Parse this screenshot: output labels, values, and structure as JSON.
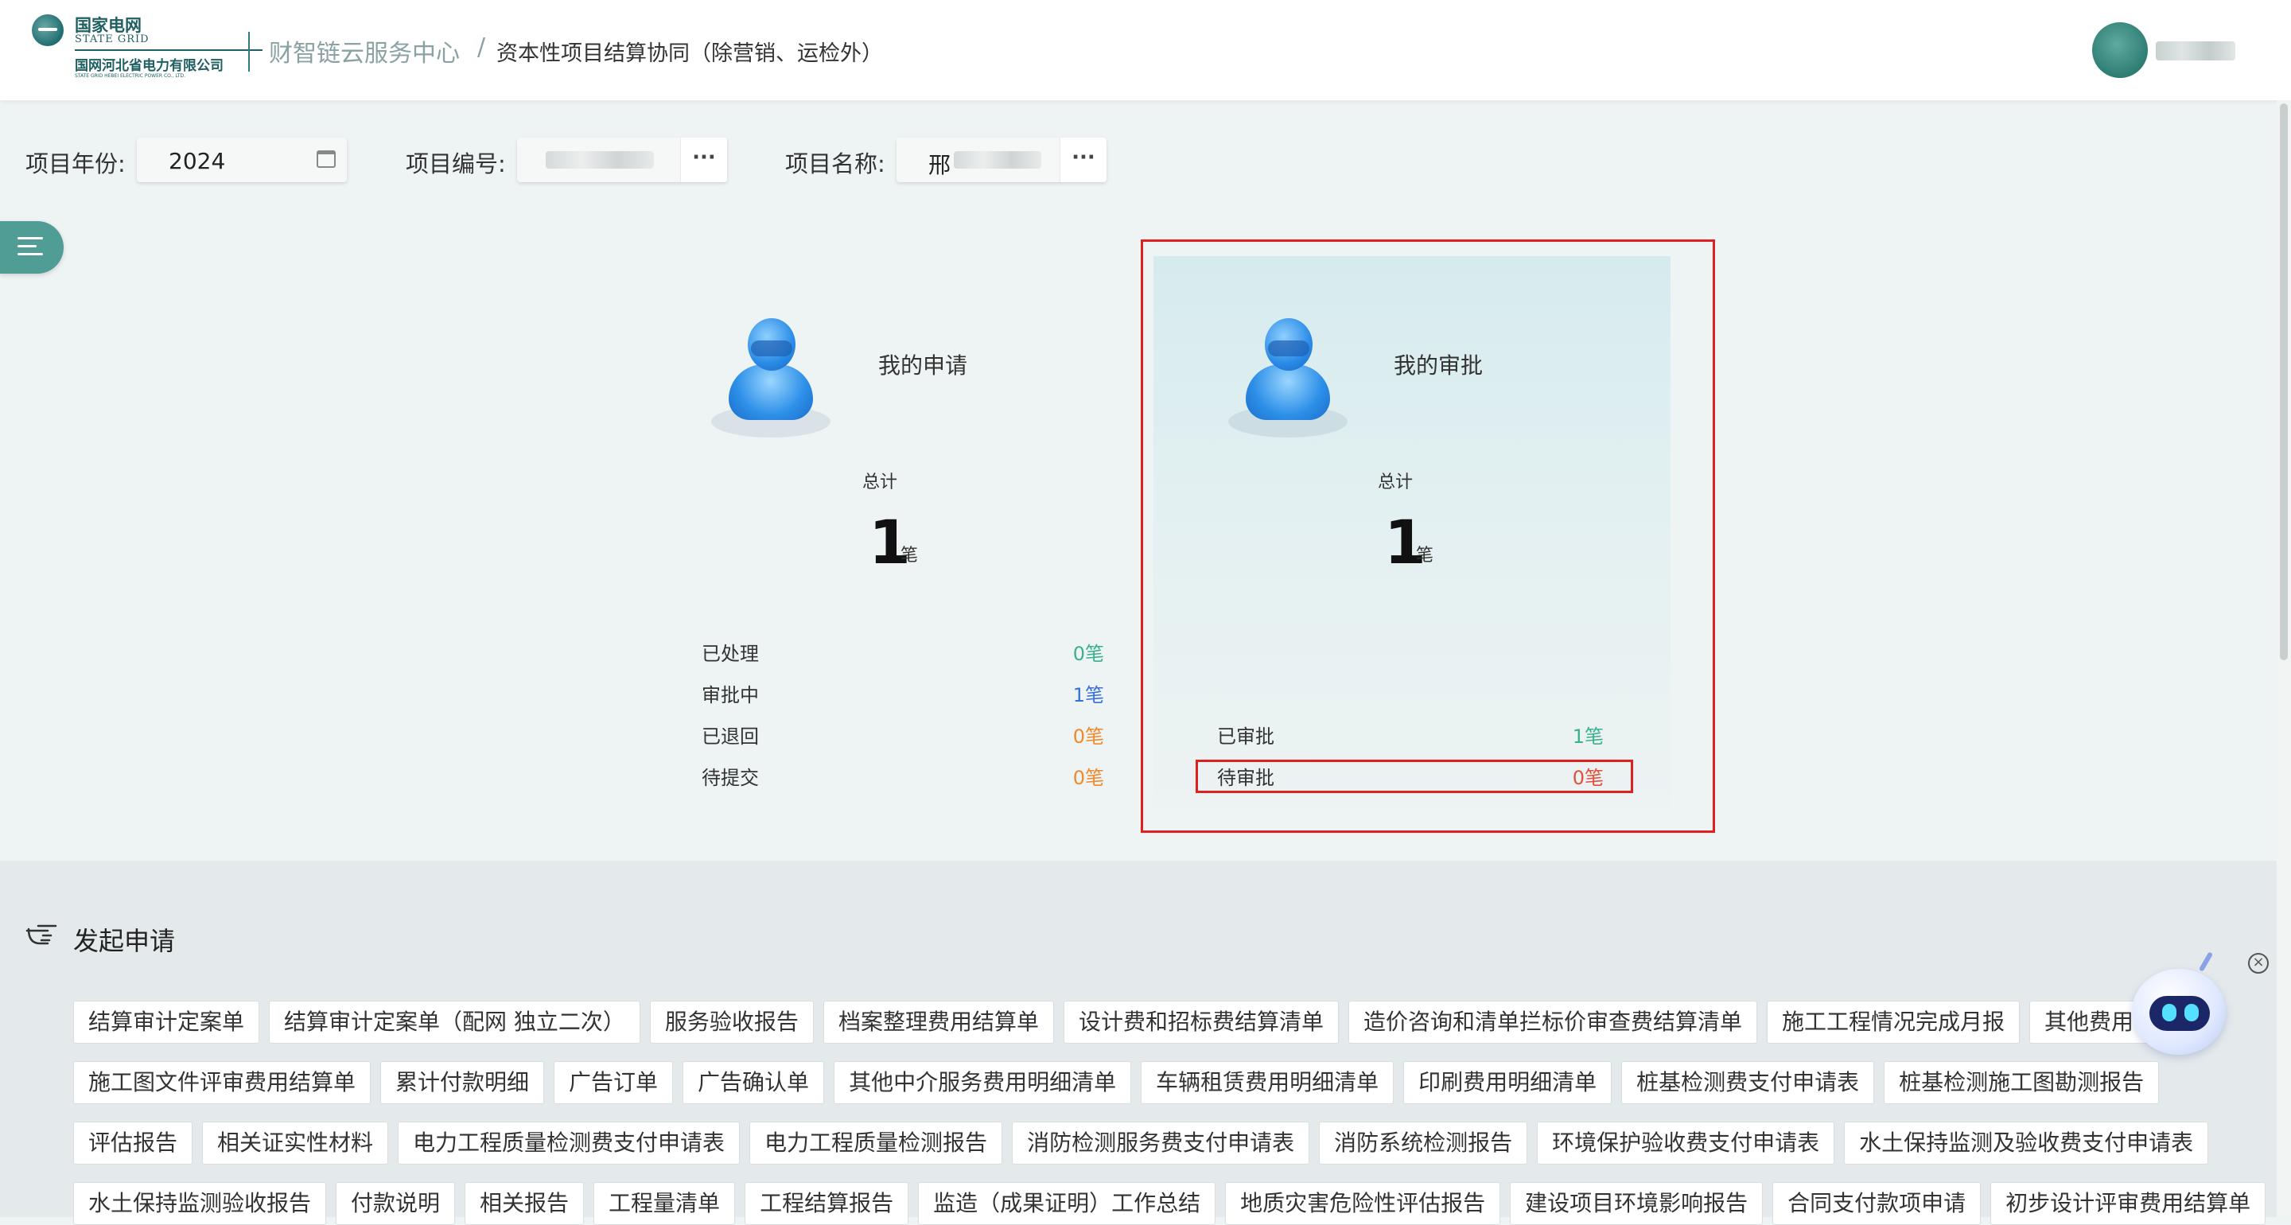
{
  "header": {
    "logo": {
      "cn": "国家电网",
      "en": "STATE GRID",
      "company": "国网河北省电力有限公司",
      "company_en": "STATE GRID HEBEI ELECTRIC POWER CO., LTD."
    },
    "breadcrumb_home": "财智链云服务中心",
    "breadcrumb_sep": "/",
    "breadcrumb_current": "资本性项目结算协同（除营销、运检外）"
  },
  "filters": {
    "year_label": "项目年份:",
    "year_value": "2024",
    "code_label": "项目编号:",
    "code_more": "···",
    "name_label": "项目名称:",
    "name_value_prefix": "邢",
    "name_more": "···"
  },
  "my_application": {
    "title": "我的申请",
    "total_label": "总计",
    "total": "1",
    "unit": "笔",
    "stats": [
      {
        "label": "已处理",
        "value": "0笔",
        "color": "#3bb08f"
      },
      {
        "label": "审批中",
        "value": "1笔",
        "color": "#3a6fd8"
      },
      {
        "label": "已退回",
        "value": "0笔",
        "color": "#ee8a2c"
      },
      {
        "label": "待提交",
        "value": "0笔",
        "color": "#ee8a2c"
      }
    ]
  },
  "my_approval": {
    "title": "我的审批",
    "total_label": "总计",
    "total": "1",
    "unit": "笔",
    "stats": [
      {
        "label": "已审批",
        "value": "1笔",
        "color": "#3bb08f"
      },
      {
        "label": "待审批",
        "value": "0笔",
        "color": "#e24f3c"
      }
    ]
  },
  "initiate": {
    "title": "发起申请",
    "rows": [
      [
        "结算审计定案单",
        "结算审计定案单（配网 独立二次）",
        "服务验收报告",
        "档案整理费用结算单",
        "设计费和招标费结算清单",
        "造价咨询和清单拦标价审查费结算清单",
        "施工工程情况完成月报",
        "其他费用明"
      ],
      [
        "施工图文件评审费用结算单",
        "累计付款明细",
        "广告订单",
        "广告确认单",
        "其他中介服务费用明细清单",
        "车辆租赁费用明细清单",
        "印刷费用明细清单",
        "桩基检测费支付申请表",
        "桩基检测施工图勘测报告"
      ],
      [
        "评估报告",
        "相关证实性材料",
        "电力工程质量检测费支付申请表",
        "电力工程质量检测报告",
        "消防检测服务费支付申请表",
        "消防系统检测报告",
        "环境保护验收费支付申请表",
        "水土保持监测及验收费支付申请表"
      ],
      [
        "水土保持监测验收报告",
        "付款说明",
        "相关报告",
        "工程量清单",
        "工程结算报告",
        "监造（成果证明）工作总结",
        "地质灾害危险性评估报告",
        "建设项目环境影响报告",
        "合同支付款项申请",
        "初步设计评审费用结算单"
      ]
    ]
  },
  "assistant": {
    "close": "×"
  }
}
